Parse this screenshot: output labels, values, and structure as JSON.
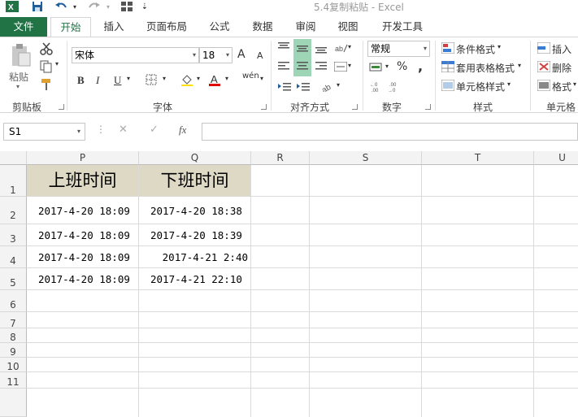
{
  "window": {
    "title": "5.4复制粘贴 - Excel"
  },
  "quick_access": {
    "excel_icon": "excel-logo-icon",
    "save": "save-icon",
    "undo": "undo-icon",
    "redo": "redo-icon",
    "customize": "customize-icon"
  },
  "tabs": [
    "文件",
    "开始",
    "插入",
    "页面布局",
    "公式",
    "数据",
    "审阅",
    "视图",
    "开发工具"
  ],
  "ribbon": {
    "clipboard": {
      "paste_label": "粘贴",
      "group_label": "剪贴板"
    },
    "font": {
      "family": "宋体",
      "size": "18",
      "grow": "A",
      "shrink": "A",
      "bold": "B",
      "italic": "I",
      "underline": "U",
      "wen": "wén",
      "group_label": "字体"
    },
    "alignment": {
      "group_label": "对齐方式"
    },
    "number": {
      "format": "常规",
      "percent": "%",
      "comma": ",",
      "group_label": "数字"
    },
    "styles": {
      "conditional": "条件格式",
      "table": "套用表格格式",
      "cell_styles": "单元格样式",
      "group_label": "样式"
    },
    "cells": {
      "insert": "插入",
      "delete": "删除",
      "format": "格式",
      "group_label": "单元格"
    }
  },
  "formula_bar": {
    "name_box": "S1",
    "fx": "fx"
  },
  "columns": [
    "P",
    "Q",
    "R",
    "S",
    "T",
    "U"
  ],
  "rows": [
    "1",
    "2",
    "3",
    "4",
    "5",
    "6",
    "7",
    "8",
    "9",
    "10",
    "11"
  ],
  "cells": {
    "header_p": "上班时间",
    "header_q": "下班时间",
    "p": [
      "2017-4-20 18:09",
      "2017-4-20 18:09",
      "2017-4-20 18:09",
      "2017-4-20 18:09"
    ],
    "q": [
      "2017-4-20 18:38",
      "2017-4-20 18:39",
      "2017-4-21 2:40",
      "2017-4-21 22:10"
    ]
  },
  "colors": {
    "accent": "#217346",
    "header_fill": "#ddd9c4",
    "font_red": "#e00000"
  }
}
